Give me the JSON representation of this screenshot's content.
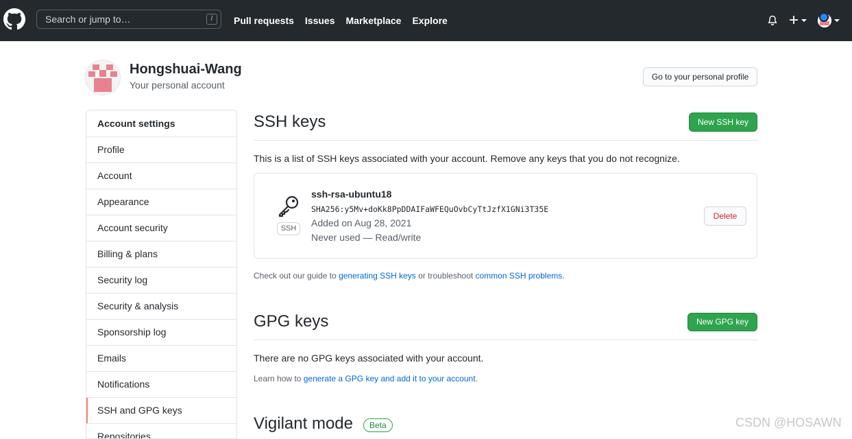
{
  "header": {
    "search_placeholder": "Search or jump to…",
    "search_hint": "/",
    "nav": [
      "Pull requests",
      "Issues",
      "Marketplace",
      "Explore"
    ]
  },
  "account": {
    "name": "Hongshuai-Wang",
    "subtitle": "Your personal account",
    "profile_button": "Go to your personal profile"
  },
  "sidebar": {
    "heading": "Account settings",
    "items": [
      {
        "label": "Profile"
      },
      {
        "label": "Account"
      },
      {
        "label": "Appearance"
      },
      {
        "label": "Account security"
      },
      {
        "label": "Billing & plans"
      },
      {
        "label": "Security log"
      },
      {
        "label": "Security & analysis"
      },
      {
        "label": "Sponsorship log"
      },
      {
        "label": "Emails"
      },
      {
        "label": "Notifications"
      },
      {
        "label": "SSH and GPG keys",
        "selected": true
      },
      {
        "label": "Repositories"
      }
    ]
  },
  "ssh": {
    "title": "SSH keys",
    "new_button": "New SSH key",
    "intro": "This is a list of SSH keys associated with your account. Remove any keys that you do not recognize.",
    "key": {
      "badge": "SSH",
      "name": "ssh-rsa-ubuntu18",
      "fingerprint": "SHA256:y5Mv+doKk8PpDDAIFaWFEQuOvbCyTtJzfX1GNi3T35E",
      "added": "Added on Aug 28, 2021",
      "usage": "Never used — Read/write",
      "delete_button": "Delete"
    },
    "guide": {
      "pre": "Check out our guide to ",
      "link1": "generating SSH keys",
      "mid": " or troubleshoot ",
      "link2": "common SSH problems",
      "post": "."
    }
  },
  "gpg": {
    "title": "GPG keys",
    "new_button": "New GPG key",
    "empty": "There are no GPG keys associated with your account.",
    "learn": {
      "pre": "Learn how to ",
      "link": "generate a GPG key and add it to your account",
      "post": "."
    }
  },
  "vigilant": {
    "title": "Vigilant mode",
    "badge": "Beta"
  },
  "watermark": "CSDN @HOSAWN",
  "colors": {
    "header_bg": "#24292e",
    "primary_green": "#2ea44f",
    "link_blue": "#0366d6",
    "danger_red": "#cb2431",
    "selected_marker": "#f9826c"
  }
}
